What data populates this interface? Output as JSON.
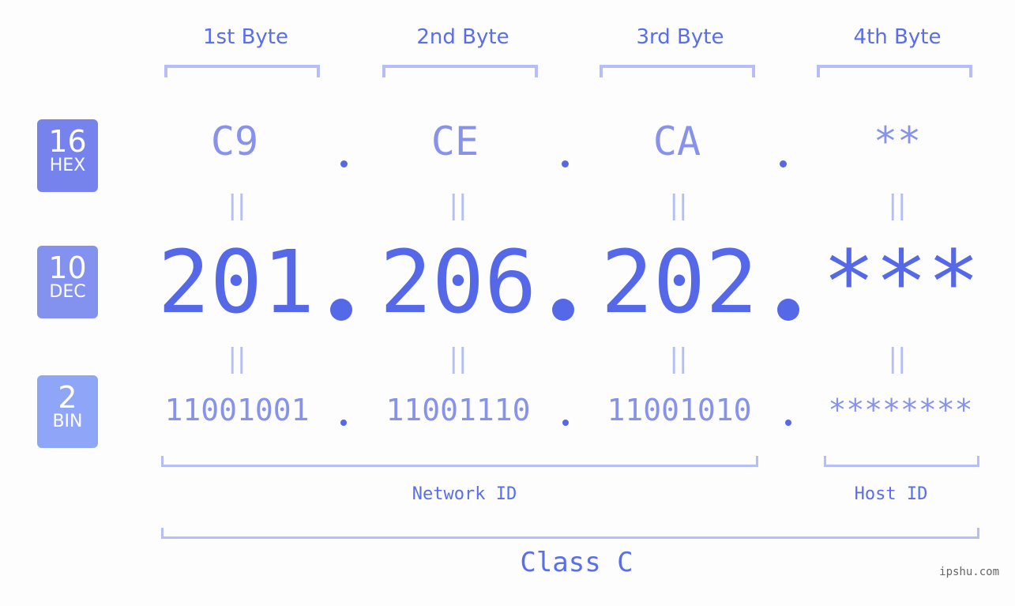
{
  "byte_headers": [
    "1st Byte",
    "2nd Byte",
    "3rd Byte",
    "4th Byte"
  ],
  "badges": [
    {
      "number": "16",
      "label": "HEX",
      "color": "#7683ec"
    },
    {
      "number": "10",
      "label": "DEC",
      "color": "#8492ef"
    },
    {
      "number": "2",
      "label": "BIN",
      "color": "#8fa6f8"
    }
  ],
  "hex": [
    "C9",
    "CE",
    "CA",
    "**"
  ],
  "dec": [
    "201",
    "206",
    "202",
    "***"
  ],
  "bin": [
    "11001001",
    "11001110",
    "11001010",
    "********"
  ],
  "separator": ".",
  "equals": "||",
  "network_id_label": "Network ID",
  "host_id_label": "Host ID",
  "class_label": "Class C",
  "watermark": "ipshu.com",
  "colors": {
    "primary": "#5568e8",
    "light": "#8692ec",
    "bracket": "#b5bef7",
    "background": "#fcfdfc"
  }
}
